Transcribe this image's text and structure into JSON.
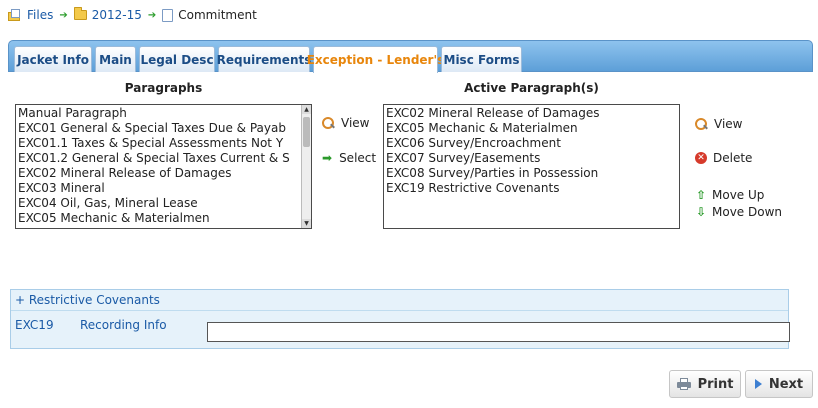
{
  "breadcrumb": {
    "items": [
      "Files",
      "2012-15",
      "Commitment"
    ]
  },
  "tabs": [
    {
      "label": "Jacket Info",
      "active": false
    },
    {
      "label": "Main",
      "active": false
    },
    {
      "label": "Legal Desc",
      "active": false
    },
    {
      "label": "Requirements",
      "active": false
    },
    {
      "label": "Exception - Lender's",
      "active": true
    },
    {
      "label": "Misc Forms",
      "active": false
    }
  ],
  "paragraphs": {
    "title": "Paragraphs",
    "options": [
      "Manual Paragraph",
      "EXC01 General & Special Taxes Due & Payab",
      "EXC01.1 Taxes & Special Assessments Not Y",
      "EXC01.2 General & Special Taxes Current & S",
      "EXC02 Mineral Release of Damages",
      "EXC03 Mineral",
      "EXC04 Oil, Gas, Mineral Lease",
      "EXC05 Mechanic & Materialmen"
    ],
    "view_label": "View",
    "select_label": "Select"
  },
  "active_paragraphs": {
    "title": "Active Paragraph(s)",
    "options": [
      "EXC02 Mineral Release of Damages",
      "EXC05 Mechanic & Materialmen",
      "EXC06 Survey/Encroachment",
      "EXC07 Survey/Easements",
      "EXC08 Survey/Parties in Possession",
      "EXC19 Restrictive Covenants"
    ],
    "view_label": "View",
    "delete_label": "Delete",
    "move_up_label": "Move Up",
    "move_down_label": "Move Down"
  },
  "restrictive_covenants": {
    "header": "+ Restrictive Covenants",
    "code": "EXC19",
    "field_label": "Recording Info",
    "field_value": ""
  },
  "buttons": {
    "print": "Print",
    "next": "Next"
  },
  "colors": {
    "tabbar": "#5d9fd8",
    "active_tab_text": "#e8860c",
    "link": "#1a5aa6",
    "panel_bg": "#e6f2fa"
  }
}
